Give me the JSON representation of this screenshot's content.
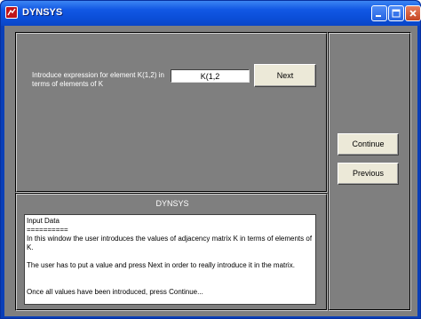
{
  "window": {
    "title": "DYNSYS",
    "controls": [
      "minimize-icon",
      "maximize-icon",
      "close-icon"
    ]
  },
  "input_panel": {
    "prompt": "Introduce expression for element K(1,2) in terms of elements of K",
    "expression_value": "K(1,2",
    "next_label": "Next"
  },
  "side_panel": {
    "continue_label": "Continue",
    "previous_label": "Previous"
  },
  "info_panel": {
    "title": "DYNSYS",
    "lines": [
      "Input Data",
      "==========",
      "In this window the user introduces the values of adjacency matrix K in terms of elements of K.",
      "",
      "The user has to put a value and press Next in order to really introduce it in the matrix.",
      "",
      "",
      "Once all values have been introduced, press Continue..."
    ]
  },
  "colors": {
    "client_background": "#7f7f7f",
    "titlebar": "#0b4ed8",
    "button_face": "#ece9d8"
  }
}
